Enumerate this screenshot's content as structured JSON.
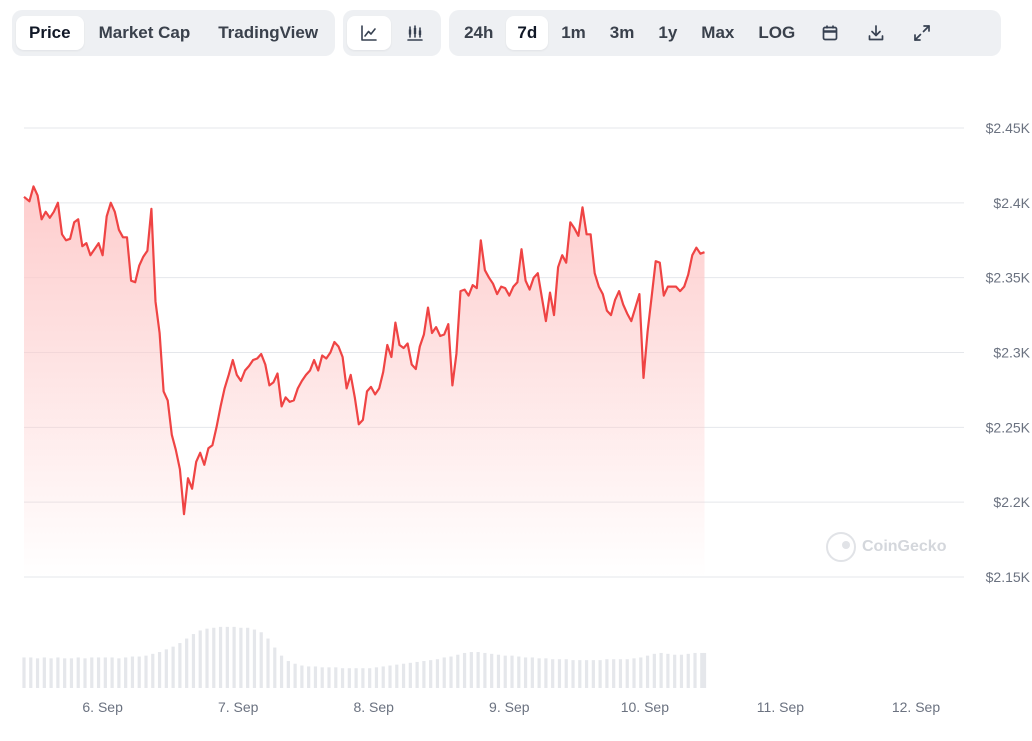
{
  "toolbar": {
    "view_tabs": [
      {
        "label": "Price",
        "active": true
      },
      {
        "label": "Market Cap",
        "active": false
      },
      {
        "label": "TradingView",
        "active": false
      }
    ],
    "chart_type_buttons": [
      {
        "icon": "line-chart-icon",
        "active": true
      },
      {
        "icon": "candlestick-chart-icon",
        "active": false
      }
    ],
    "ranges": [
      {
        "label": "24h",
        "active": false
      },
      {
        "label": "7d",
        "active": true
      },
      {
        "label": "1m",
        "active": false
      },
      {
        "label": "3m",
        "active": false
      },
      {
        "label": "1y",
        "active": false
      },
      {
        "label": "Max",
        "active": false
      },
      {
        "label": "LOG",
        "active": false
      }
    ],
    "action_icons": [
      "calendar-icon",
      "download-icon",
      "expand-icon"
    ]
  },
  "watermark": {
    "text": "CoinGecko",
    "icon": "coingecko-logo-icon"
  },
  "colors": {
    "line": "#ef4444",
    "fill_top": "#fecaca",
    "grid": "#e5e7eb",
    "volume": "#e5e7eb",
    "axis_text": "#6b7280"
  },
  "chart_data": {
    "type": "area",
    "ylim": [
      2150,
      2450
    ],
    "yticks": [
      {
        "value": 2450,
        "label": "$2.45K"
      },
      {
        "value": 2400,
        "label": "$2.4K"
      },
      {
        "value": 2350,
        "label": "$2.35K"
      },
      {
        "value": 2300,
        "label": "$2.3K"
      },
      {
        "value": 2250,
        "label": "$2.25K"
      },
      {
        "value": 2200,
        "label": "$2.2K"
      },
      {
        "value": 2150,
        "label": "$2.15K"
      }
    ],
    "xlim": [
      5.42,
      12.31
    ],
    "xticks": [
      {
        "value": 6,
        "label": "6. Sep"
      },
      {
        "value": 7,
        "label": "7. Sep"
      },
      {
        "value": 8,
        "label": "8. Sep"
      },
      {
        "value": 9,
        "label": "9. Sep"
      },
      {
        "value": 10,
        "label": "10. Sep"
      },
      {
        "value": 11,
        "label": "11. Sep"
      },
      {
        "value": 12,
        "label": "12. Sep"
      }
    ],
    "price": [
      [
        5.42,
        2404
      ],
      [
        5.46,
        2401
      ],
      [
        5.49,
        2411
      ],
      [
        5.52,
        2405
      ],
      [
        5.55,
        2389
      ],
      [
        5.58,
        2394
      ],
      [
        5.61,
        2390
      ],
      [
        5.64,
        2394
      ],
      [
        5.67,
        2400
      ],
      [
        5.7,
        2379
      ],
      [
        5.73,
        2375
      ],
      [
        5.76,
        2376
      ],
      [
        5.79,
        2387
      ],
      [
        5.82,
        2389
      ],
      [
        5.85,
        2371
      ],
      [
        5.88,
        2373
      ],
      [
        5.91,
        2365
      ],
      [
        5.94,
        2369
      ],
      [
        5.97,
        2373
      ],
      [
        6.0,
        2365
      ],
      [
        6.03,
        2391
      ],
      [
        6.06,
        2400
      ],
      [
        6.09,
        2394
      ],
      [
        6.12,
        2382
      ],
      [
        6.15,
        2377
      ],
      [
        6.18,
        2377
      ],
      [
        6.21,
        2348
      ],
      [
        6.24,
        2347
      ],
      [
        6.27,
        2358
      ],
      [
        6.3,
        2364
      ],
      [
        6.33,
        2368
      ],
      [
        6.36,
        2396
      ],
      [
        6.39,
        2334
      ],
      [
        6.42,
        2313
      ],
      [
        6.45,
        2274
      ],
      [
        6.48,
        2268
      ],
      [
        6.51,
        2245
      ],
      [
        6.54,
        2235
      ],
      [
        6.57,
        2222
      ],
      [
        6.6,
        2192
      ],
      [
        6.63,
        2216
      ],
      [
        6.66,
        2209
      ],
      [
        6.69,
        2227
      ],
      [
        6.72,
        2233
      ],
      [
        6.75,
        2225
      ],
      [
        6.78,
        2236
      ],
      [
        6.81,
        2238
      ],
      [
        6.84,
        2250
      ],
      [
        6.87,
        2264
      ],
      [
        6.9,
        2276
      ],
      [
        6.93,
        2285
      ],
      [
        6.96,
        2295
      ],
      [
        6.99,
        2285
      ],
      [
        7.02,
        2281
      ],
      [
        7.05,
        2288
      ],
      [
        7.08,
        2291
      ],
      [
        7.11,
        2295
      ],
      [
        7.14,
        2296
      ],
      [
        7.17,
        2299
      ],
      [
        7.2,
        2292
      ],
      [
        7.23,
        2278
      ],
      [
        7.26,
        2280
      ],
      [
        7.29,
        2286
      ],
      [
        7.32,
        2264
      ],
      [
        7.35,
        2270
      ],
      [
        7.38,
        2267
      ],
      [
        7.41,
        2268
      ],
      [
        7.44,
        2276
      ],
      [
        7.47,
        2281
      ],
      [
        7.5,
        2285
      ],
      [
        7.53,
        2288
      ],
      [
        7.56,
        2295
      ],
      [
        7.59,
        2288
      ],
      [
        7.62,
        2298
      ],
      [
        7.65,
        2296
      ],
      [
        7.68,
        2300
      ],
      [
        7.71,
        2307
      ],
      [
        7.74,
        2304
      ],
      [
        7.77,
        2297
      ],
      [
        7.8,
        2276
      ],
      [
        7.83,
        2285
      ],
      [
        7.86,
        2270
      ],
      [
        7.89,
        2252
      ],
      [
        7.92,
        2255
      ],
      [
        7.95,
        2274
      ],
      [
        7.98,
        2277
      ],
      [
        8.01,
        2272
      ],
      [
        8.04,
        2276
      ],
      [
        8.07,
        2287
      ],
      [
        8.1,
        2305
      ],
      [
        8.13,
        2297
      ],
      [
        8.16,
        2320
      ],
      [
        8.19,
        2305
      ],
      [
        8.22,
        2303
      ],
      [
        8.25,
        2306
      ],
      [
        8.28,
        2292
      ],
      [
        8.31,
        2289
      ],
      [
        8.34,
        2304
      ],
      [
        8.37,
        2312
      ],
      [
        8.4,
        2330
      ],
      [
        8.43,
        2313
      ],
      [
        8.46,
        2317
      ],
      [
        8.49,
        2311
      ],
      [
        8.52,
        2312
      ],
      [
        8.55,
        2319
      ],
      [
        8.58,
        2278
      ],
      [
        8.61,
        2299
      ],
      [
        8.64,
        2341
      ],
      [
        8.67,
        2342
      ],
      [
        8.7,
        2338
      ],
      [
        8.73,
        2345
      ],
      [
        8.76,
        2343
      ],
      [
        8.79,
        2375
      ],
      [
        8.82,
        2355
      ],
      [
        8.85,
        2350
      ],
      [
        8.88,
        2346
      ],
      [
        8.91,
        2339
      ],
      [
        8.94,
        2344
      ],
      [
        8.97,
        2343
      ],
      [
        9.0,
        2338
      ],
      [
        9.03,
        2344
      ],
      [
        9.06,
        2347
      ],
      [
        9.09,
        2369
      ],
      [
        9.12,
        2348
      ],
      [
        9.15,
        2342
      ],
      [
        9.18,
        2350
      ],
      [
        9.21,
        2353
      ],
      [
        9.24,
        2337
      ],
      [
        9.27,
        2321
      ],
      [
        9.3,
        2340
      ],
      [
        9.33,
        2325
      ],
      [
        9.36,
        2357
      ],
      [
        9.39,
        2365
      ],
      [
        9.42,
        2360
      ],
      [
        9.45,
        2387
      ],
      [
        9.48,
        2383
      ],
      [
        9.51,
        2378
      ],
      [
        9.54,
        2397
      ],
      [
        9.57,
        2379
      ],
      [
        9.6,
        2379
      ],
      [
        9.63,
        2353
      ],
      [
        9.66,
        2344
      ],
      [
        9.69,
        2339
      ],
      [
        9.72,
        2328
      ],
      [
        9.75,
        2325
      ],
      [
        9.78,
        2335
      ],
      [
        9.81,
        2341
      ],
      [
        9.84,
        2332
      ],
      [
        9.87,
        2326
      ],
      [
        9.9,
        2321
      ],
      [
        9.93,
        2330
      ],
      [
        9.96,
        2339
      ],
      [
        9.99,
        2283
      ],
      [
        10.02,
        2314
      ],
      [
        10.05,
        2337
      ],
      [
        10.08,
        2361
      ],
      [
        10.11,
        2360
      ],
      [
        10.14,
        2338
      ],
      [
        10.17,
        2344
      ],
      [
        10.2,
        2344
      ],
      [
        10.23,
        2344
      ],
      [
        10.26,
        2341
      ],
      [
        10.29,
        2344
      ],
      [
        10.32,
        2352
      ],
      [
        10.35,
        2365
      ],
      [
        10.38,
        2370
      ],
      [
        10.41,
        2366
      ],
      [
        10.44,
        2367
      ]
    ],
    "volume": [
      [
        5.42,
        0.34
      ],
      [
        5.47,
        0.34
      ],
      [
        5.52,
        0.33
      ],
      [
        5.57,
        0.34
      ],
      [
        5.62,
        0.33
      ],
      [
        5.67,
        0.34
      ],
      [
        5.72,
        0.33
      ],
      [
        5.77,
        0.33
      ],
      [
        5.82,
        0.34
      ],
      [
        5.87,
        0.33
      ],
      [
        5.92,
        0.34
      ],
      [
        5.97,
        0.34
      ],
      [
        6.02,
        0.34
      ],
      [
        6.07,
        0.34
      ],
      [
        6.12,
        0.33
      ],
      [
        6.17,
        0.34
      ],
      [
        6.22,
        0.35
      ],
      [
        6.27,
        0.35
      ],
      [
        6.32,
        0.36
      ],
      [
        6.37,
        0.38
      ],
      [
        6.42,
        0.4
      ],
      [
        6.47,
        0.43
      ],
      [
        6.52,
        0.46
      ],
      [
        6.57,
        0.5
      ],
      [
        6.62,
        0.55
      ],
      [
        6.67,
        0.6
      ],
      [
        6.72,
        0.64
      ],
      [
        6.77,
        0.66
      ],
      [
        6.82,
        0.67
      ],
      [
        6.87,
        0.68
      ],
      [
        6.92,
        0.68
      ],
      [
        6.97,
        0.68
      ],
      [
        7.02,
        0.67
      ],
      [
        7.07,
        0.67
      ],
      [
        7.12,
        0.65
      ],
      [
        7.17,
        0.62
      ],
      [
        7.22,
        0.55
      ],
      [
        7.27,
        0.45
      ],
      [
        7.32,
        0.36
      ],
      [
        7.37,
        0.3
      ],
      [
        7.42,
        0.27
      ],
      [
        7.47,
        0.25
      ],
      [
        7.52,
        0.24
      ],
      [
        7.57,
        0.24
      ],
      [
        7.62,
        0.23
      ],
      [
        7.67,
        0.23
      ],
      [
        7.72,
        0.23
      ],
      [
        7.77,
        0.22
      ],
      [
        7.82,
        0.22
      ],
      [
        7.87,
        0.22
      ],
      [
        7.92,
        0.22
      ],
      [
        7.97,
        0.22
      ],
      [
        8.02,
        0.23
      ],
      [
        8.07,
        0.24
      ],
      [
        8.12,
        0.25
      ],
      [
        8.17,
        0.26
      ],
      [
        8.22,
        0.27
      ],
      [
        8.27,
        0.28
      ],
      [
        8.32,
        0.29
      ],
      [
        8.37,
        0.3
      ],
      [
        8.42,
        0.31
      ],
      [
        8.47,
        0.32
      ],
      [
        8.52,
        0.34
      ],
      [
        8.57,
        0.35
      ],
      [
        8.62,
        0.37
      ],
      [
        8.67,
        0.39
      ],
      [
        8.72,
        0.4
      ],
      [
        8.77,
        0.4
      ],
      [
        8.82,
        0.39
      ],
      [
        8.87,
        0.38
      ],
      [
        8.92,
        0.37
      ],
      [
        8.97,
        0.36
      ],
      [
        9.02,
        0.36
      ],
      [
        9.07,
        0.35
      ],
      [
        9.12,
        0.34
      ],
      [
        9.17,
        0.34
      ],
      [
        9.22,
        0.33
      ],
      [
        9.27,
        0.33
      ],
      [
        9.32,
        0.32
      ],
      [
        9.37,
        0.32
      ],
      [
        9.42,
        0.32
      ],
      [
        9.47,
        0.31
      ],
      [
        9.52,
        0.31
      ],
      [
        9.57,
        0.31
      ],
      [
        9.62,
        0.31
      ],
      [
        9.67,
        0.31
      ],
      [
        9.72,
        0.32
      ],
      [
        9.77,
        0.32
      ],
      [
        9.82,
        0.32
      ],
      [
        9.87,
        0.32
      ],
      [
        9.92,
        0.33
      ],
      [
        9.97,
        0.34
      ],
      [
        10.02,
        0.36
      ],
      [
        10.07,
        0.38
      ],
      [
        10.12,
        0.39
      ],
      [
        10.17,
        0.38
      ],
      [
        10.22,
        0.37
      ],
      [
        10.27,
        0.37
      ],
      [
        10.32,
        0.38
      ],
      [
        10.37,
        0.39
      ],
      [
        10.42,
        0.39
      ],
      [
        10.44,
        0.39
      ]
    ]
  }
}
